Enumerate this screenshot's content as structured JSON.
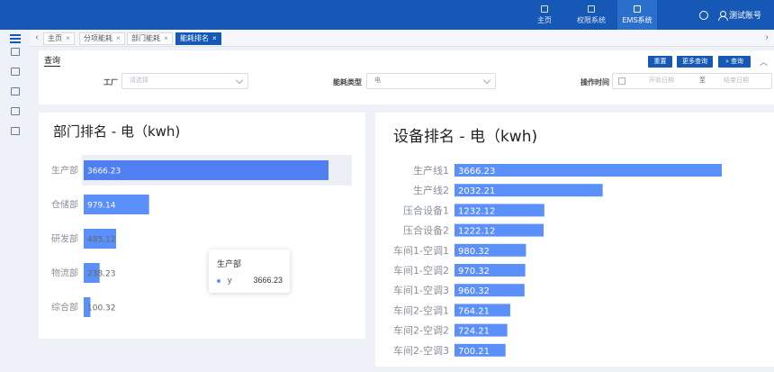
{
  "header": {
    "nav": [
      {
        "label": "主页",
        "icon": "home-icon"
      },
      {
        "label": "权限系统",
        "icon": "permission-icon"
      },
      {
        "label": "EMS系统",
        "icon": "ems-icon"
      }
    ],
    "user_label": "测试账号"
  },
  "tabs": [
    {
      "label": "主页",
      "active": false
    },
    {
      "label": "分项能耗",
      "active": false
    },
    {
      "label": "部门能耗",
      "active": false
    },
    {
      "label": "能耗排名",
      "active": true
    }
  ],
  "query": {
    "title": "查询",
    "buttons": {
      "reset": "重置",
      "more": "更多查询",
      "search": "查询"
    },
    "factory_label": "工厂",
    "factory_placeholder": "请选择",
    "energy_type_label": "能耗类型",
    "energy_type_value": "电",
    "time_label": "操作时间",
    "start_placeholder": "开始日期",
    "range_sep": "至",
    "end_placeholder": "结束日期"
  },
  "colors": {
    "header": "#1658b5",
    "bar": "#5b8ff9",
    "bar_highlight": "#4f7ff0",
    "hover_band": "#eceff6"
  },
  "chart_data": [
    {
      "type": "bar",
      "orientation": "horizontal",
      "title": "部门排名 - 电（kwh)",
      "categories": [
        "生产部",
        "仓储部",
        "研发部",
        "物流部",
        "综合部"
      ],
      "values": [
        3666.23,
        979.14,
        485.12,
        238.23,
        100.32
      ],
      "labels": [
        "3666.23",
        "979.14",
        "485.12",
        "238.23",
        "100.32"
      ],
      "tooltip": {
        "title": "生产部",
        "series": "y",
        "value": "3666.23"
      }
    },
    {
      "type": "bar",
      "orientation": "horizontal",
      "title": "设备排名 - 电（kwh)",
      "categories": [
        "生产线1",
        "生产线2",
        "压合设备1",
        "压合设备2",
        "车间1-空调1",
        "车间1-空调2",
        "车间1-空调3",
        "车间2-空调1",
        "车间2-空调2",
        "车间2-空调3"
      ],
      "values": [
        3666.23,
        2032.21,
        1232.12,
        1222.12,
        980.32,
        970.32,
        960.32,
        764.21,
        724.21,
        700.21
      ],
      "labels": [
        "3666.23",
        "2032.21",
        "1232.12",
        "1222.12",
        "980.32",
        "970.32",
        "960.32",
        "764.21",
        "724.21",
        "700.21"
      ]
    }
  ]
}
